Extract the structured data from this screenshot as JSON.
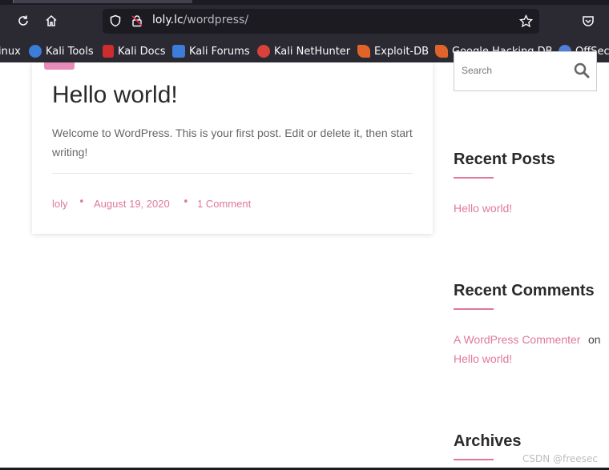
{
  "browser": {
    "url_host": "loly.lc",
    "url_path": "/wordpress/",
    "bookmarks": [
      {
        "label": "inux",
        "icon": "kali-linux-icon",
        "color": "#3b7dd8"
      },
      {
        "label": "Kali Tools",
        "icon": "kali-tools-icon",
        "color": "#3b7dd8"
      },
      {
        "label": "Kali Docs",
        "icon": "kali-docs-icon",
        "color": "#cc2d2d"
      },
      {
        "label": "Kali Forums",
        "icon": "kali-forums-icon",
        "color": "#3b7dd8"
      },
      {
        "label": "Kali NetHunter",
        "icon": "kali-nethunter-icon",
        "color": "#d9423a"
      },
      {
        "label": "Exploit-DB",
        "icon": "exploit-db-icon",
        "color": "#e0642a"
      },
      {
        "label": "Google Hacking DB",
        "icon": "google-hacking-db-icon",
        "color": "#e0642a"
      },
      {
        "label": "OffSec",
        "icon": "offsec-icon",
        "color": "#4f7fd6"
      }
    ]
  },
  "post": {
    "title": "Hello world!",
    "excerpt": "Welcome to WordPress. This is your first post. Edit or delete it, then start writing!",
    "author": "loly",
    "date": "August 19, 2020",
    "comments": "1 Comment"
  },
  "sidebar": {
    "search_placeholder": "Search",
    "recent_posts_title": "Recent Posts",
    "recent_posts": [
      "Hello world!"
    ],
    "recent_comments_title": "Recent Comments",
    "recent_comment_author": "A WordPress Commenter",
    "recent_comment_on": "on",
    "recent_comment_post": "Hello world!",
    "archives_title": "Archives"
  },
  "colors": {
    "accent": "#e0779f",
    "chrome": "#2b2a33"
  },
  "watermark": "CSDN @freesec"
}
